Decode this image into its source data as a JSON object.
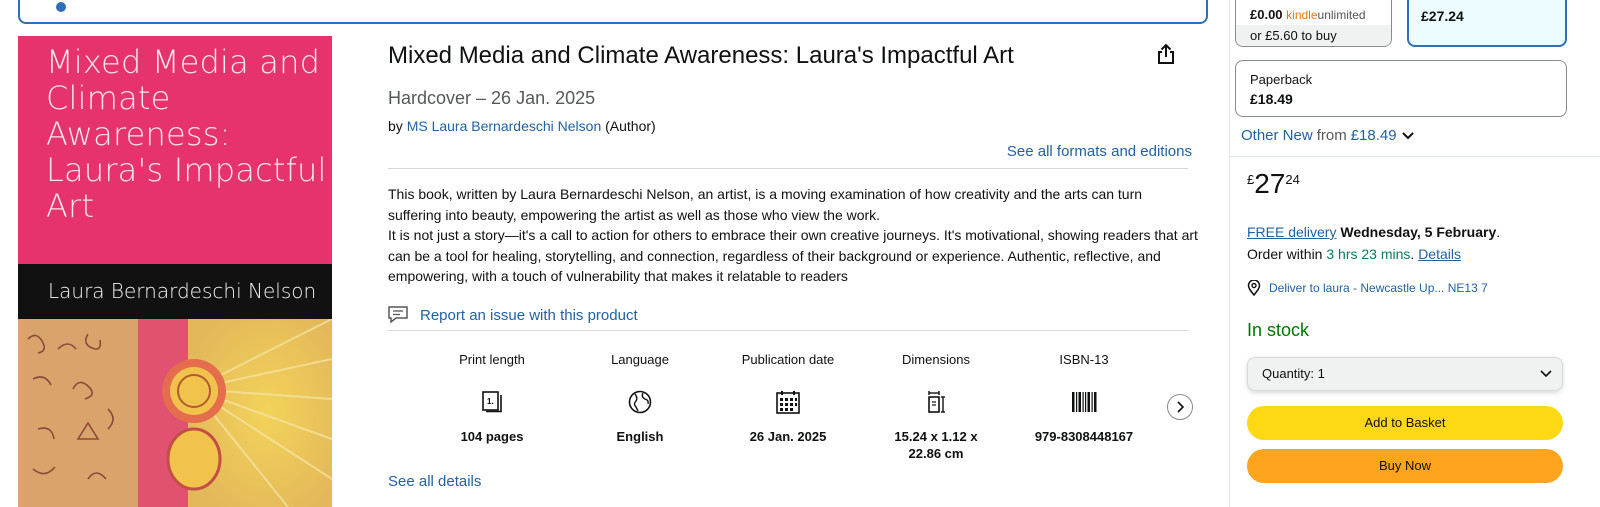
{
  "cover": {
    "title": "Mixed Media and Climate Awareness: Laura's Impactful Art",
    "author": "Laura Bernardeschi Nelson"
  },
  "product": {
    "title": "Mixed Media and Climate Awareness: Laura's Impactful Art",
    "format": "Hardcover – 26 Jan. 2025",
    "by_prefix": "by",
    "author": "MS Laura Bernardeschi Nelson",
    "author_role": "(Author)",
    "see_formats": "See all formats and editions",
    "description_1": "This book, written by Laura Bernardeschi Nelson, an artist, is a moving examination of how creativity and the arts can turn suffering into beauty, empowering the artist as well as those who view the work.",
    "description_2": "It is not just a story—it's a call to action for others to embrace their own creative journeys. It's motivational, showing readers that art can be a tool for healing, storytelling, and connection, regardless of their background or experience. Authentic, reflective, and empowering, with a touch of vulnerability that makes it relatable to readers",
    "report_issue": "Report an issue with this product",
    "see_all_details": "See all details"
  },
  "attributes": [
    {
      "label": "Print length",
      "icon": "book-pages-icon",
      "value": "104 pages"
    },
    {
      "label": "Language",
      "icon": "globe-icon",
      "value": "English"
    },
    {
      "label": "Publication date",
      "icon": "calendar-icon",
      "value": "26 Jan. 2025"
    },
    {
      "label": "Dimensions",
      "icon": "dimensions-icon",
      "value": "15.24 x 1.12 x 22.86 cm"
    },
    {
      "label": "ISBN-13",
      "icon": "barcode-icon",
      "value": "979-8308448167"
    }
  ],
  "buybox": {
    "kindle_price": "£0.00",
    "kindle_ku_1": "kindle",
    "kindle_ku_2": "unlimited",
    "kindle_buy": "or £5.60 to buy",
    "hardcover_price": "£27.24",
    "paperback_label": "Paperback",
    "paperback_price": "£18.49",
    "other_new_label": "Other New",
    "other_new_from": "from",
    "other_new_price": "£18.49",
    "price_currency": "£",
    "price_whole": "27",
    "price_fraction": "24",
    "free_delivery": "FREE delivery",
    "delivery_date": "Wednesday, 5 February",
    "order_within_prefix": "Order within",
    "order_within_time": "3 hrs 23 mins",
    "details_link": "Details",
    "deliver_to": "Deliver to laura - Newcastle Up... NE13 7",
    "stock": "In stock",
    "quantity": "Quantity: 1",
    "add_to_basket": "Add to Basket",
    "buy_now": "Buy Now"
  },
  "colors": {
    "link": "#2162a1",
    "cover_pink": "#e6336e",
    "add_to_basket": "#ffd814",
    "buy_now": "#ffa41c",
    "in_stock": "#007600",
    "selected_border": "#2f6fb5"
  }
}
